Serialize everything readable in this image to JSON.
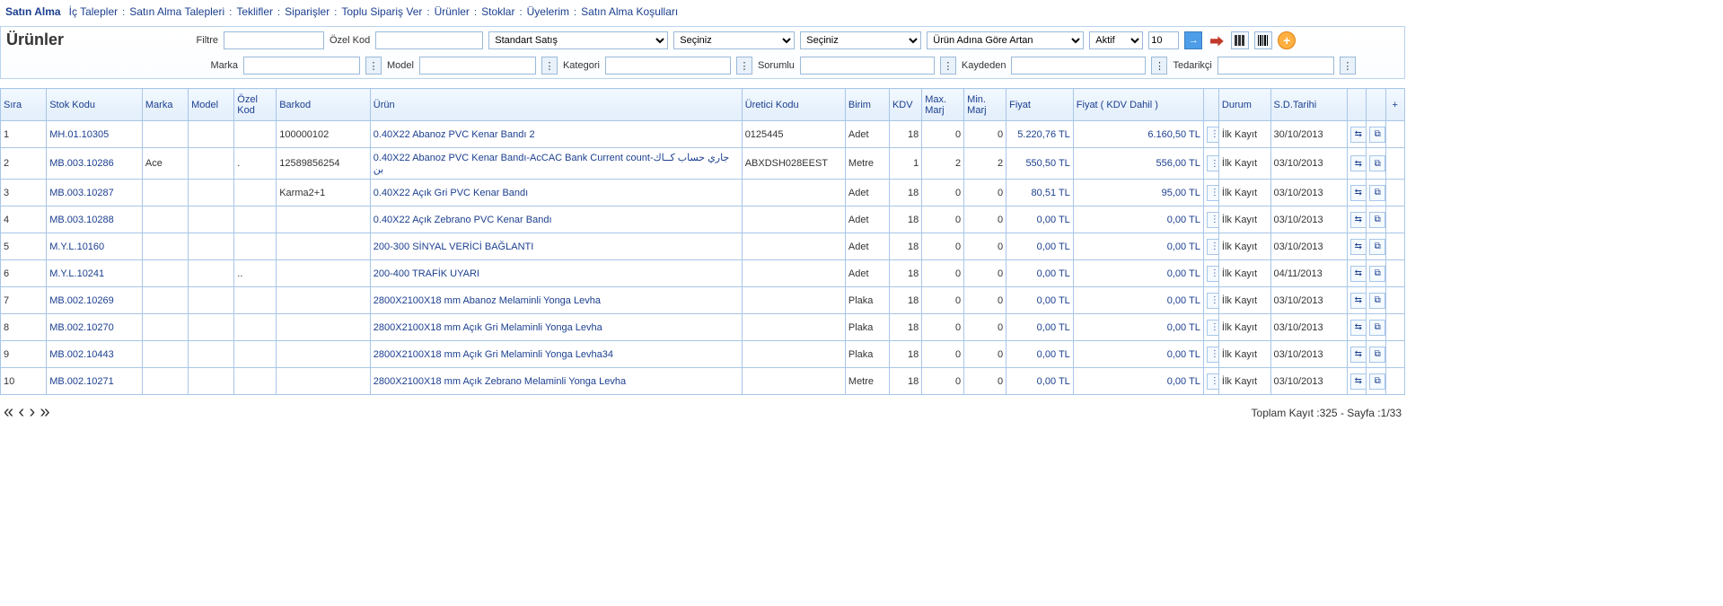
{
  "nav": {
    "brand": "Satın Alma",
    "items": [
      "İç Talepler",
      "Satın Alma Talepleri",
      "Teklifler",
      "Siparişler",
      "Toplu Sipariş Ver",
      "Ürünler",
      "Stoklar",
      "Üyelerim",
      "Satın Alma Koşulları"
    ]
  },
  "panel": {
    "title": "Ürünler",
    "row1": {
      "filter_lbl": "Filtre",
      "ozelkod_lbl": "Özel Kod",
      "select1": "Standart Satış",
      "select2": "Seçiniz",
      "select3": "Seçiniz",
      "sort": "Ürün Adına Göre Artan",
      "status": "Aktif",
      "pagesize": "10"
    },
    "row2": {
      "marka_lbl": "Marka",
      "model_lbl": "Model",
      "kategori_lbl": "Kategori",
      "sorumlu_lbl": "Sorumlu",
      "kaydeden_lbl": "Kaydeden",
      "tedarikci_lbl": "Tedarikçi"
    }
  },
  "columns": [
    "Sıra",
    "Stok Kodu",
    "Marka",
    "Model",
    "Özel Kod",
    "Barkod",
    "Ürün",
    "Üretici Kodu",
    "Birim",
    "KDV",
    "Max. Marj",
    "Min. Marj",
    "Fiyat",
    "Fiyat ( KDV Dahil )",
    "",
    "Durum",
    "S.D.Tarihi",
    "",
    "",
    "+"
  ],
  "rows": [
    {
      "sira": "1",
      "stok": "MH.01.10305",
      "marka": "",
      "model": "",
      "ozel": "",
      "barkod": "100000102",
      "urun": "0.40X22 Abanoz PVC Kenar Bandı 2",
      "uretici": "0125445",
      "birim": "Adet",
      "kdv": "18",
      "max": "0",
      "min": "0",
      "fiyat": "5.220,76 TL",
      "fiyatkdv": "6.160,50 TL",
      "durum": "İlk Kayıt",
      "tarih": "30/10/2013"
    },
    {
      "sira": "2",
      "stok": "MB.003.10286",
      "marka": "Ace",
      "model": "",
      "ozel": ".",
      "barkod": "12589856254",
      "urun": "0.40X22 Abanoz PVC Kenar Bandı-AcCAC Bank Current count-جاري حساب كــاك بن",
      "uretici": "ABXDSH028EEST",
      "birim": "Metre",
      "kdv": "1",
      "max": "2",
      "min": "2",
      "fiyat": "550,50 TL",
      "fiyatkdv": "556,00 TL",
      "durum": "İlk Kayıt",
      "tarih": "03/10/2013"
    },
    {
      "sira": "3",
      "stok": "MB.003.10287",
      "marka": "",
      "model": "",
      "ozel": "",
      "barkod": "Karma2+1",
      "urun": "0.40X22 Açık Gri PVC Kenar Bandı",
      "uretici": "",
      "birim": "Adet",
      "kdv": "18",
      "max": "0",
      "min": "0",
      "fiyat": "80,51 TL",
      "fiyatkdv": "95,00 TL",
      "durum": "İlk Kayıt",
      "tarih": "03/10/2013"
    },
    {
      "sira": "4",
      "stok": "MB.003.10288",
      "marka": "",
      "model": "",
      "ozel": "",
      "barkod": "",
      "urun": "0.40X22 Açık Zebrano PVC Kenar Bandı",
      "uretici": "",
      "birim": "Adet",
      "kdv": "18",
      "max": "0",
      "min": "0",
      "fiyat": "0,00 TL",
      "fiyatkdv": "0,00 TL",
      "durum": "İlk Kayıt",
      "tarih": "03/10/2013"
    },
    {
      "sira": "5",
      "stok": "M.Y.L.10160",
      "marka": "",
      "model": "",
      "ozel": "",
      "barkod": "",
      "urun": "200-300 SİNYAL VERİCİ BAĞLANTI",
      "uretici": "",
      "birim": "Adet",
      "kdv": "18",
      "max": "0",
      "min": "0",
      "fiyat": "0,00 TL",
      "fiyatkdv": "0,00 TL",
      "durum": "İlk Kayıt",
      "tarih": "03/10/2013"
    },
    {
      "sira": "6",
      "stok": "M.Y.L.10241",
      "marka": "",
      "model": "",
      "ozel": "..",
      "barkod": "",
      "urun": "200-400 TRAFİK UYARI",
      "uretici": "",
      "birim": "Adet",
      "kdv": "18",
      "max": "0",
      "min": "0",
      "fiyat": "0,00 TL",
      "fiyatkdv": "0,00 TL",
      "durum": "İlk Kayıt",
      "tarih": "04/11/2013"
    },
    {
      "sira": "7",
      "stok": "MB.002.10269",
      "marka": "",
      "model": "",
      "ozel": "",
      "barkod": "",
      "urun": "2800X2100X18 mm Abanoz Melaminli Yonga Levha",
      "uretici": "",
      "birim": "Plaka",
      "kdv": "18",
      "max": "0",
      "min": "0",
      "fiyat": "0,00 TL",
      "fiyatkdv": "0,00 TL",
      "durum": "İlk Kayıt",
      "tarih": "03/10/2013"
    },
    {
      "sira": "8",
      "stok": "MB.002.10270",
      "marka": "",
      "model": "",
      "ozel": "",
      "barkod": "",
      "urun": "2800X2100X18 mm Açık Gri Melaminli Yonga Levha",
      "uretici": "",
      "birim": "Plaka",
      "kdv": "18",
      "max": "0",
      "min": "0",
      "fiyat": "0,00 TL",
      "fiyatkdv": "0,00 TL",
      "durum": "İlk Kayıt",
      "tarih": "03/10/2013"
    },
    {
      "sira": "9",
      "stok": "MB.002.10443",
      "marka": "",
      "model": "",
      "ozel": "",
      "barkod": "",
      "urun": "2800X2100X18 mm Açık Gri Melaminli Yonga Levha34",
      "uretici": "",
      "birim": "Plaka",
      "kdv": "18",
      "max": "0",
      "min": "0",
      "fiyat": "0,00 TL",
      "fiyatkdv": "0,00 TL",
      "durum": "İlk Kayıt",
      "tarih": "03/10/2013"
    },
    {
      "sira": "10",
      "stok": "MB.002.10271",
      "marka": "",
      "model": "",
      "ozel": "",
      "barkod": "",
      "urun": "2800X2100X18 mm Açık Zebrano Melaminli Yonga Levha",
      "uretici": "",
      "birim": "Metre",
      "kdv": "18",
      "max": "0",
      "min": "0",
      "fiyat": "0,00 TL",
      "fiyatkdv": "0,00 TL",
      "durum": "İlk Kayıt",
      "tarih": "03/10/2013"
    }
  ],
  "footer": {
    "total_label": "Toplam Kayıt :",
    "total": "325",
    "sep": " - ",
    "page_label": "Sayfa :",
    "page": "1/33"
  }
}
